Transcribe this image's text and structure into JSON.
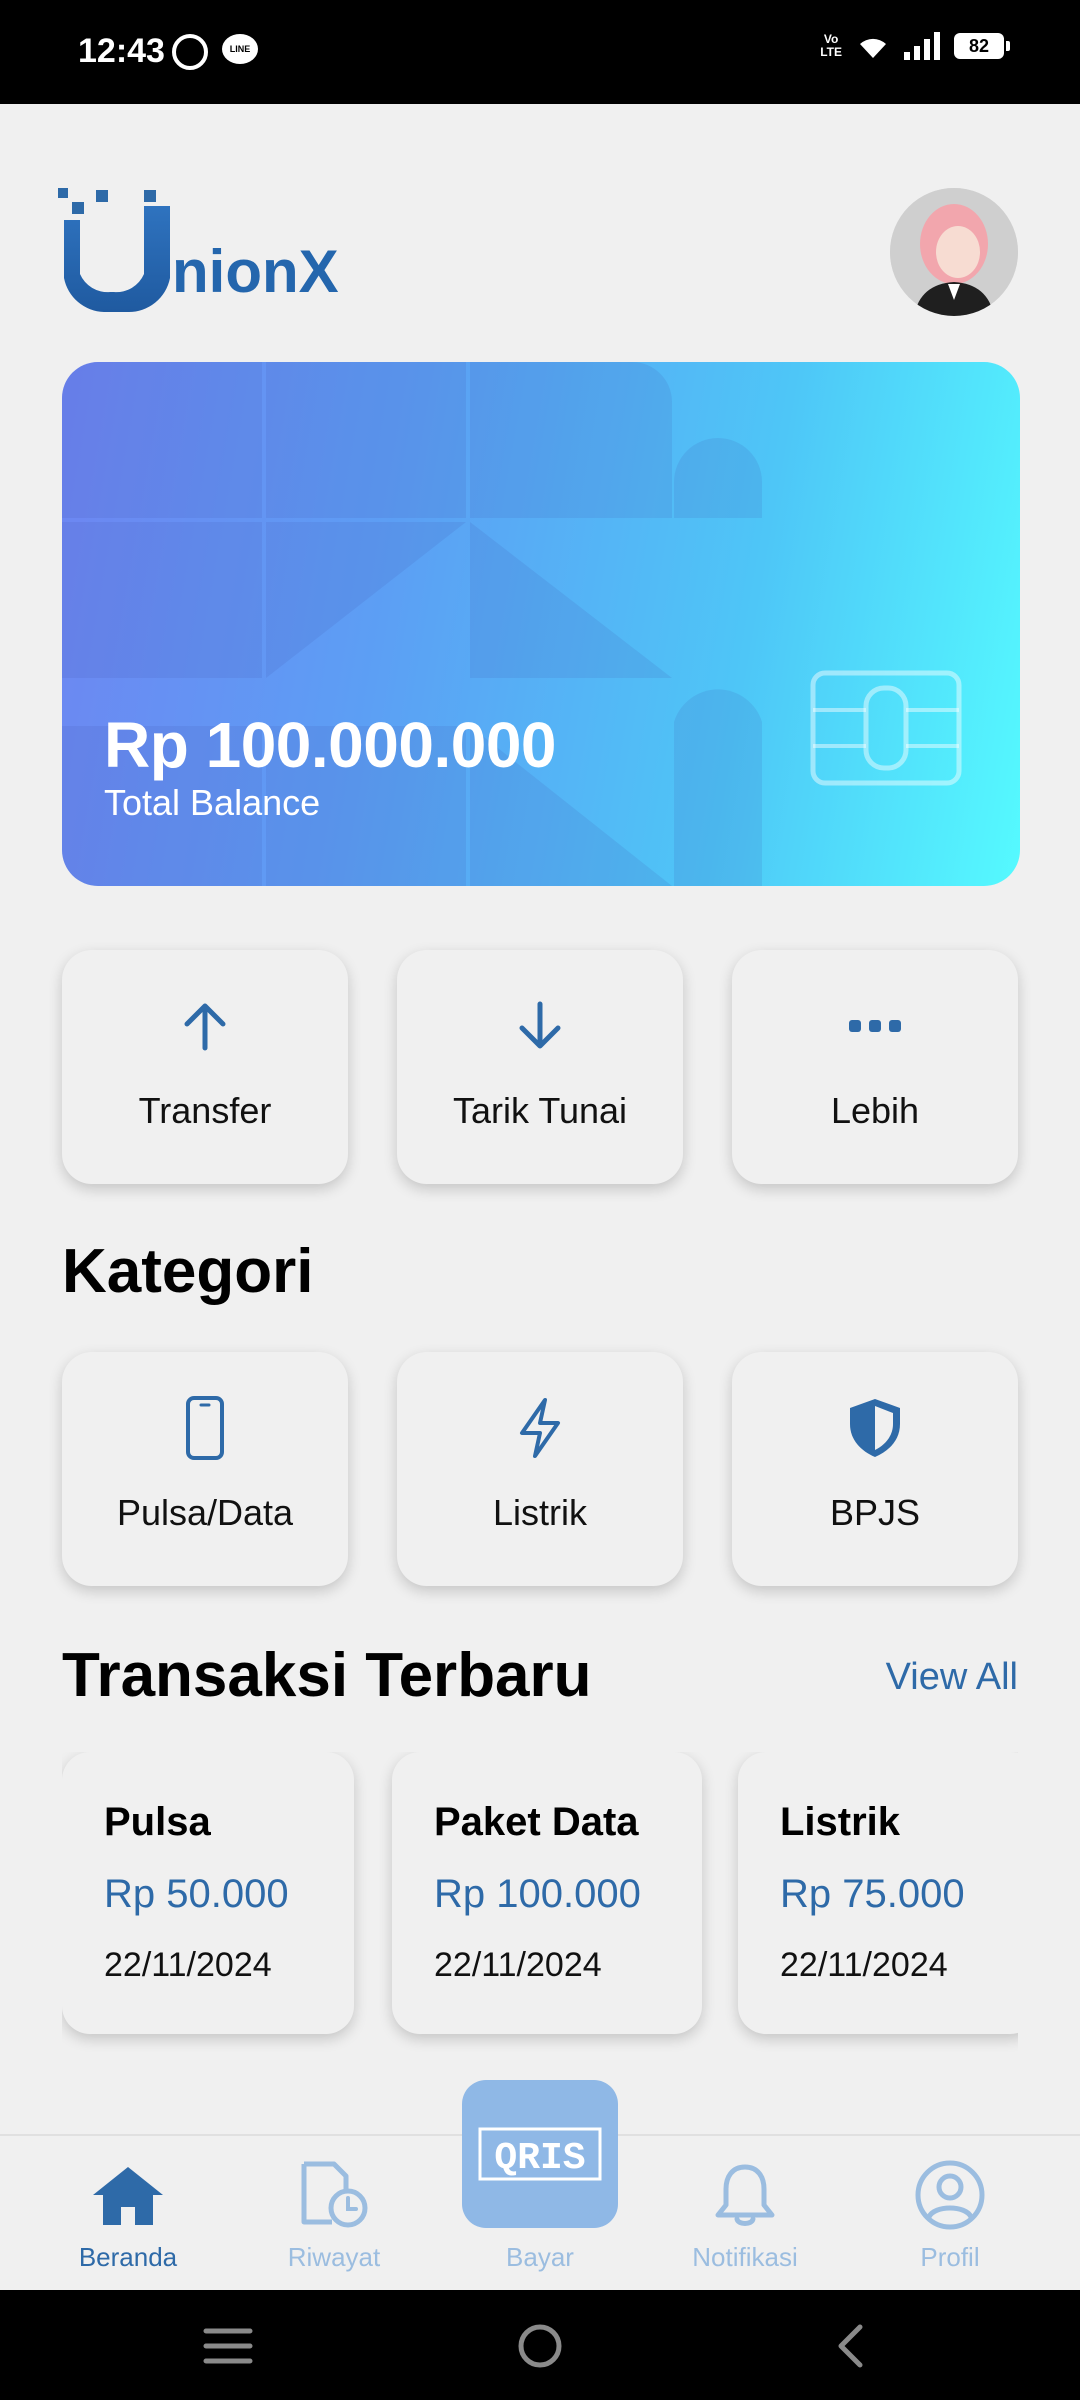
{
  "status_bar": {
    "time": "12:43",
    "battery": "82",
    "volte": "Vo\nLTE"
  },
  "header": {
    "logo_text": "nionX",
    "logo_initial": "U"
  },
  "balance": {
    "amount": "Rp 100.000.000",
    "label": "Total Balance"
  },
  "actions": [
    {
      "label": "Transfer",
      "icon": "arrow-up-icon"
    },
    {
      "label": "Tarik Tunai",
      "icon": "arrow-down-icon"
    },
    {
      "label": "Lebih",
      "icon": "more-dots-icon"
    }
  ],
  "categories_title": "Kategori",
  "categories": [
    {
      "label": "Pulsa/Data",
      "icon": "phone-icon"
    },
    {
      "label": "Listrik",
      "icon": "lightning-icon"
    },
    {
      "label": "BPJS",
      "icon": "shield-icon"
    }
  ],
  "transactions_title": "Transaksi Terbaru",
  "view_all": "View All",
  "transactions": [
    {
      "title": "Pulsa",
      "amount": "Rp 50.000",
      "date": "22/11/2024"
    },
    {
      "title": "Paket Data",
      "amount": "Rp 100.000",
      "date": "22/11/2024"
    },
    {
      "title": "Listrik",
      "amount": "Rp 75.000",
      "date": "22/11/2024"
    }
  ],
  "nav": [
    {
      "label": "Beranda",
      "icon": "home-icon",
      "active": true
    },
    {
      "label": "Riwayat",
      "icon": "history-icon",
      "active": false
    },
    {
      "label": "Bayar",
      "icon": "qris-icon",
      "active": false
    },
    {
      "label": "Notifikasi",
      "icon": "bell-icon",
      "active": false
    },
    {
      "label": "Profil",
      "icon": "profile-icon",
      "active": false
    }
  ],
  "qris_text": "QRIS",
  "colors": {
    "accent": "#2e6aa8",
    "inactive": "#9bbde0",
    "qris_bg": "#8fb8e6"
  }
}
